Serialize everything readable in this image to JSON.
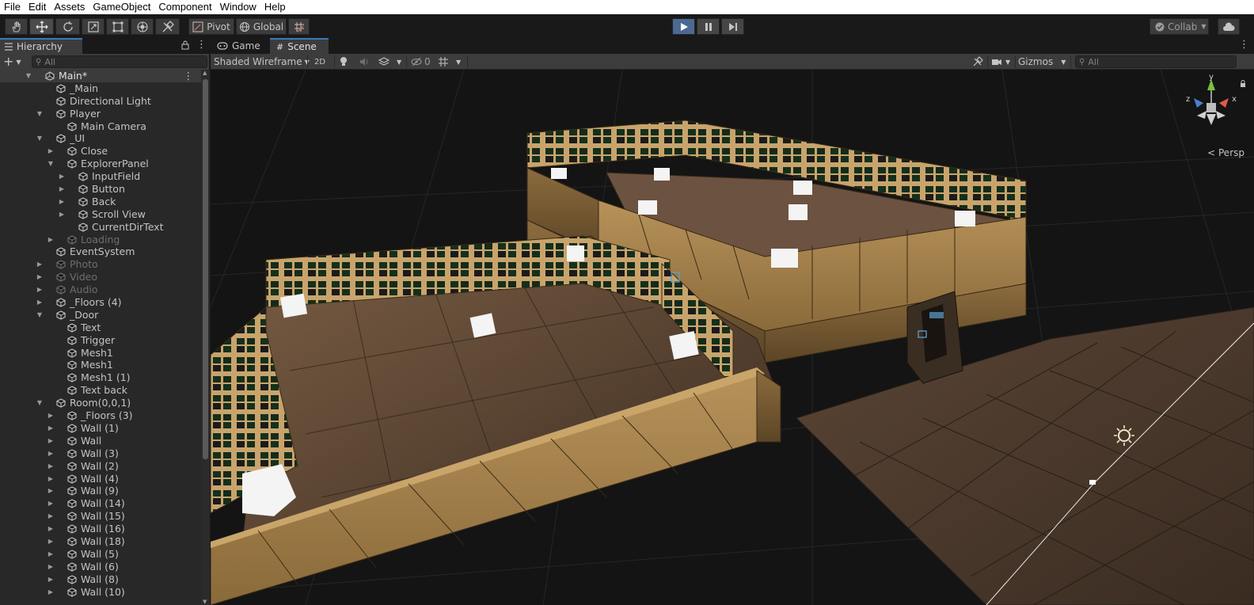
{
  "menu": [
    "File",
    "Edit",
    "Assets",
    "GameObject",
    "Component",
    "Window",
    "Help"
  ],
  "toolbar": {
    "tools": [
      "hand-tool-icon",
      "move-tool-icon",
      "rotate-tool-icon",
      "scale-tool-icon",
      "rect-tool-icon",
      "transform-tool-icon",
      "custom-tool-icon"
    ],
    "pivot_label": "Pivot",
    "global_label": "Global",
    "collab_label": "Collab",
    "play_state": "playing"
  },
  "hierarchy": {
    "tab_label": "Hierarchy",
    "search_placeholder": "All",
    "items": [
      {
        "name": "Main*",
        "depth": 0,
        "fold": "open",
        "type": "scene",
        "selected": true
      },
      {
        "name": "_Main",
        "depth": 1,
        "fold": "none"
      },
      {
        "name": "Directional Light",
        "depth": 1,
        "fold": "none"
      },
      {
        "name": "Player",
        "depth": 1,
        "fold": "open"
      },
      {
        "name": "Main Camera",
        "depth": 2,
        "fold": "none"
      },
      {
        "name": "_UI",
        "depth": 1,
        "fold": "open"
      },
      {
        "name": "Close",
        "depth": 2,
        "fold": "closed"
      },
      {
        "name": "ExplorerPanel",
        "depth": 2,
        "fold": "open"
      },
      {
        "name": "InputField",
        "depth": 3,
        "fold": "closed"
      },
      {
        "name": "Button",
        "depth": 3,
        "fold": "closed"
      },
      {
        "name": "Back",
        "depth": 3,
        "fold": "closed"
      },
      {
        "name": "Scroll View",
        "depth": 3,
        "fold": "closed"
      },
      {
        "name": "CurrentDirText",
        "depth": 3,
        "fold": "none"
      },
      {
        "name": "Loading",
        "depth": 2,
        "fold": "closed",
        "dim": true
      },
      {
        "name": "EventSystem",
        "depth": 1,
        "fold": "none"
      },
      {
        "name": "Photo",
        "depth": 1,
        "fold": "closed",
        "dim": true
      },
      {
        "name": "Video",
        "depth": 1,
        "fold": "closed",
        "dim": true
      },
      {
        "name": "Audio",
        "depth": 1,
        "fold": "closed",
        "dim": true
      },
      {
        "name": "_Floors (4)",
        "depth": 1,
        "fold": "closed"
      },
      {
        "name": "_Door",
        "depth": 1,
        "fold": "open"
      },
      {
        "name": "Text",
        "depth": 2,
        "fold": "none"
      },
      {
        "name": "Trigger",
        "depth": 2,
        "fold": "none"
      },
      {
        "name": "Mesh1",
        "depth": 2,
        "fold": "none"
      },
      {
        "name": "Mesh1",
        "depth": 2,
        "fold": "none"
      },
      {
        "name": "Mesh1 (1)",
        "depth": 2,
        "fold": "none"
      },
      {
        "name": "Text back",
        "depth": 2,
        "fold": "none"
      },
      {
        "name": "Room(0,0,1)",
        "depth": 1,
        "fold": "open"
      },
      {
        "name": "_Floors (3)",
        "depth": 2,
        "fold": "closed"
      },
      {
        "name": "Wall (1)",
        "depth": 2,
        "fold": "closed"
      },
      {
        "name": "Wall",
        "depth": 2,
        "fold": "closed"
      },
      {
        "name": "Wall (3)",
        "depth": 2,
        "fold": "closed"
      },
      {
        "name": "Wall (2)",
        "depth": 2,
        "fold": "closed"
      },
      {
        "name": "Wall (4)",
        "depth": 2,
        "fold": "closed"
      },
      {
        "name": "Wall (9)",
        "depth": 2,
        "fold": "closed"
      },
      {
        "name": "Wall (14)",
        "depth": 2,
        "fold": "closed"
      },
      {
        "name": "Wall (15)",
        "depth": 2,
        "fold": "closed"
      },
      {
        "name": "Wall (16)",
        "depth": 2,
        "fold": "closed"
      },
      {
        "name": "Wall (18)",
        "depth": 2,
        "fold": "closed"
      },
      {
        "name": "Wall (5)",
        "depth": 2,
        "fold": "closed"
      },
      {
        "name": "Wall (6)",
        "depth": 2,
        "fold": "closed"
      },
      {
        "name": "Wall (8)",
        "depth": 2,
        "fold": "closed"
      },
      {
        "name": "Wall (10)",
        "depth": 2,
        "fold": "closed"
      }
    ]
  },
  "scene": {
    "tabs": [
      {
        "label": "Game",
        "icon": "gamepad-icon",
        "active": false
      },
      {
        "label": "Scene",
        "icon": "grid-icon",
        "active": true
      }
    ],
    "draw_mode": "Shaded Wireframe",
    "mode_2d": "2D",
    "hidden_count": "0",
    "gizmos_label": "Gizmos",
    "search_placeholder": "All",
    "persp_label": "Persp",
    "gizmo_axes": {
      "x": "x",
      "y": "y",
      "z": "z"
    }
  },
  "colors": {
    "accent": "#3a79bb",
    "play_active": "#4c6994",
    "wood": "#a07c47"
  }
}
